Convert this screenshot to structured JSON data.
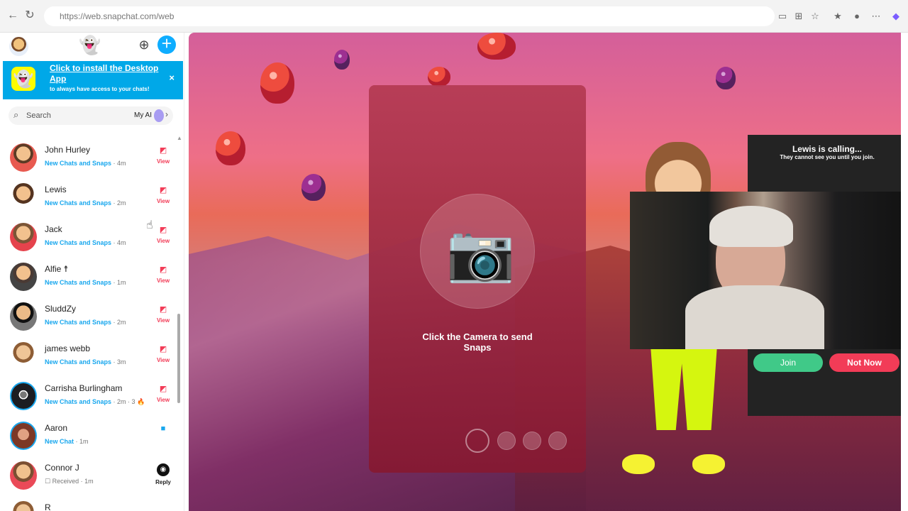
{
  "browser": {
    "url": "https://web.snapchat.com/web",
    "icons": [
      "back-icon",
      "reload-icon",
      "screen-icon",
      "grid-icon",
      "favorite-icon",
      "collections-icon",
      "profile-icon",
      "more-icon",
      "copilot-icon"
    ]
  },
  "sidebar": {
    "install_title": "Click to install the Desktop App",
    "install_subtitle": "to always have access to your chats!",
    "search_placeholder": "Search",
    "my_ai_label": "My AI"
  },
  "chats": [
    {
      "name": "John Hurley",
      "status": "New Chats and Snaps",
      "time": "· 4m",
      "action": "View"
    },
    {
      "name": "Lewis",
      "status": "New Chats and Snaps",
      "time": "· 2m",
      "action": "View"
    },
    {
      "name": "Jack",
      "status": "New Chats and Snaps",
      "time": "· 4m",
      "action": "View"
    },
    {
      "name": "Alfie ☨",
      "status": "New Chats and Snaps",
      "time": "· 1m",
      "action": "View"
    },
    {
      "name": "SluddZy",
      "status": "New Chats and Snaps",
      "time": "· 2m",
      "action": "View"
    },
    {
      "name": "james webb",
      "status": "New Chats and Snaps",
      "time": "· 3m",
      "action": "View"
    },
    {
      "name": "Carrisha Burlingham",
      "status": "New Chats and Snaps",
      "time": "· 2m · 3 🔥",
      "action": "View"
    },
    {
      "name": "Aaron",
      "status": "New Chat",
      "time": "· 1m",
      "action": ""
    },
    {
      "name": "Connor J",
      "status": "Received",
      "time": "· 1m",
      "action": "Reply"
    },
    {
      "name": "R",
      "status": "",
      "time": "",
      "action": ""
    }
  ],
  "camera": {
    "prompt": "Click the Camera to send Snaps"
  },
  "call": {
    "title": "Lewis is calling...",
    "subtitle": "They cannot see you until you join.",
    "join_label": "Join",
    "not_now_label": "Not Now"
  },
  "colors": {
    "snap_blue": "#0EADFF",
    "view_red": "#F23C57",
    "join_green": "#40C988",
    "yellow": "#FFFC00"
  }
}
